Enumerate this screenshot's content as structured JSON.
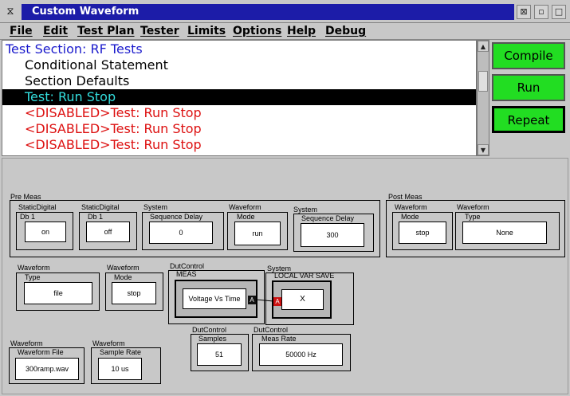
{
  "window": {
    "title": "Custom Waveform"
  },
  "menu": [
    "File",
    "Edit",
    "Test Plan",
    "Tester",
    "Limits",
    "Options",
    "Help",
    "Debug"
  ],
  "tree": {
    "items": [
      {
        "text": "Test Section: RF Tests",
        "color": "#1a1acc"
      },
      {
        "text": "Conditional Statement",
        "color": "#000000"
      },
      {
        "text": "Section Defaults",
        "color": "#000000"
      },
      {
        "text": "Test: Run Stop",
        "color": "#33dddd",
        "selected": true
      },
      {
        "text": "<DISABLED>Test: Run Stop",
        "color": "#dd1111"
      },
      {
        "text": "<DISABLED>Test: Run Stop",
        "color": "#dd1111"
      },
      {
        "text": "<DISABLED>Test: Run Stop",
        "color": "#dd1111"
      }
    ]
  },
  "buttons": {
    "compile": "Compile",
    "run": "Run",
    "repeat": "Repeat"
  },
  "canvas": {
    "pre_meas": {
      "label": "Pre Meas",
      "static1": {
        "type": "StaticDigital",
        "param": "Db 1",
        "value": "on"
      },
      "static2": {
        "type": "StaticDigital",
        "param": "Db 1",
        "value": "off"
      },
      "system1": {
        "type": "System",
        "param": "Sequence Delay",
        "value": "0"
      },
      "waveform1": {
        "type": "Waveform",
        "param": "Mode",
        "value": "run"
      },
      "system2": {
        "type": "System",
        "param": "Sequence Delay",
        "value": "300"
      }
    },
    "post_meas": {
      "label": "Post Meas",
      "waveform_mode": {
        "type": "Waveform",
        "param": "Mode",
        "value": "stop"
      },
      "waveform_type": {
        "type": "Waveform",
        "param": "Type",
        "value": "None"
      }
    },
    "waveform_type": {
      "type": "Waveform",
      "param": "Type",
      "value": "file"
    },
    "waveform_mode": {
      "type": "Waveform",
      "param": "Mode",
      "value": "stop"
    },
    "dutcontrol_meas": {
      "type": "DutControl",
      "param": "MEAS",
      "value": "Voltage Vs Time",
      "port": "A"
    },
    "system_localvar": {
      "type": "System",
      "param": "LOCAL VAR SAVE",
      "value": "X",
      "port": "A"
    },
    "waveform_file": {
      "type": "Waveform",
      "param": "Waveform File",
      "value": "300ramp.wav"
    },
    "waveform_rate": {
      "type": "Waveform",
      "param": "Sample Rate",
      "value": "10 us"
    },
    "dut_samples": {
      "type": "DutControl",
      "param": "Samples",
      "value": "51"
    },
    "dut_measrate": {
      "type": "DutControl",
      "param": "Meas Rate",
      "value": "50000 Hz"
    }
  }
}
